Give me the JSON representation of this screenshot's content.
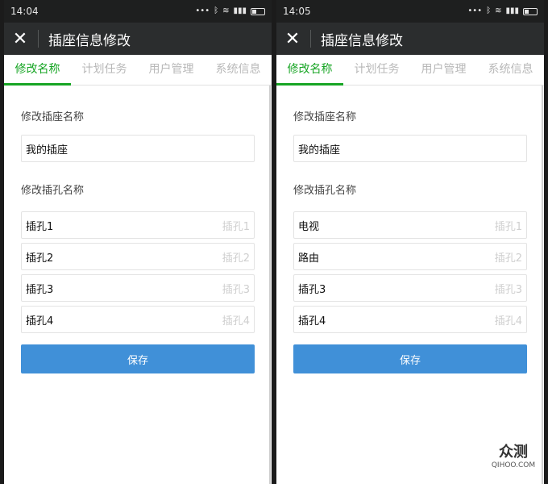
{
  "screens": [
    {
      "time": "14:04",
      "title": "插座信息修改",
      "tabs": [
        "修改名称",
        "计划任务",
        "用户管理",
        "系统信息"
      ],
      "socket_section_label": "修改插座名称",
      "socket_name_value": "我的插座",
      "outlet_section_label": "修改插孔名称",
      "outlets": [
        {
          "value": "插孔1",
          "placeholder": "插孔1"
        },
        {
          "value": "插孔2",
          "placeholder": "插孔2"
        },
        {
          "value": "插孔3",
          "placeholder": "插孔3"
        },
        {
          "value": "插孔4",
          "placeholder": "插孔4"
        }
      ],
      "save_label": "保存"
    },
    {
      "time": "14:05",
      "title": "插座信息修改",
      "tabs": [
        "修改名称",
        "计划任务",
        "用户管理",
        "系统信息"
      ],
      "socket_section_label": "修改插座名称",
      "socket_name_value": "我的插座",
      "outlet_section_label": "修改插孔名称",
      "outlets": [
        {
          "value": "电视",
          "placeholder": "插孔1"
        },
        {
          "value": "路由",
          "placeholder": "插孔2"
        },
        {
          "value": "插孔3",
          "placeholder": "插孔3"
        },
        {
          "value": "插孔4",
          "placeholder": "插孔4"
        }
      ],
      "save_label": "保存"
    }
  ],
  "status_icons": [
    "ellipsis",
    "bluetooth-icon",
    "wifi-icon",
    "signal-icon",
    "battery-icon"
  ],
  "colors": {
    "accent_green": "#17a524",
    "save_blue": "#4090d8",
    "title_bar": "#2b2d2e"
  },
  "watermark": {
    "brand": "众测",
    "url": "QIHOO.COM"
  }
}
